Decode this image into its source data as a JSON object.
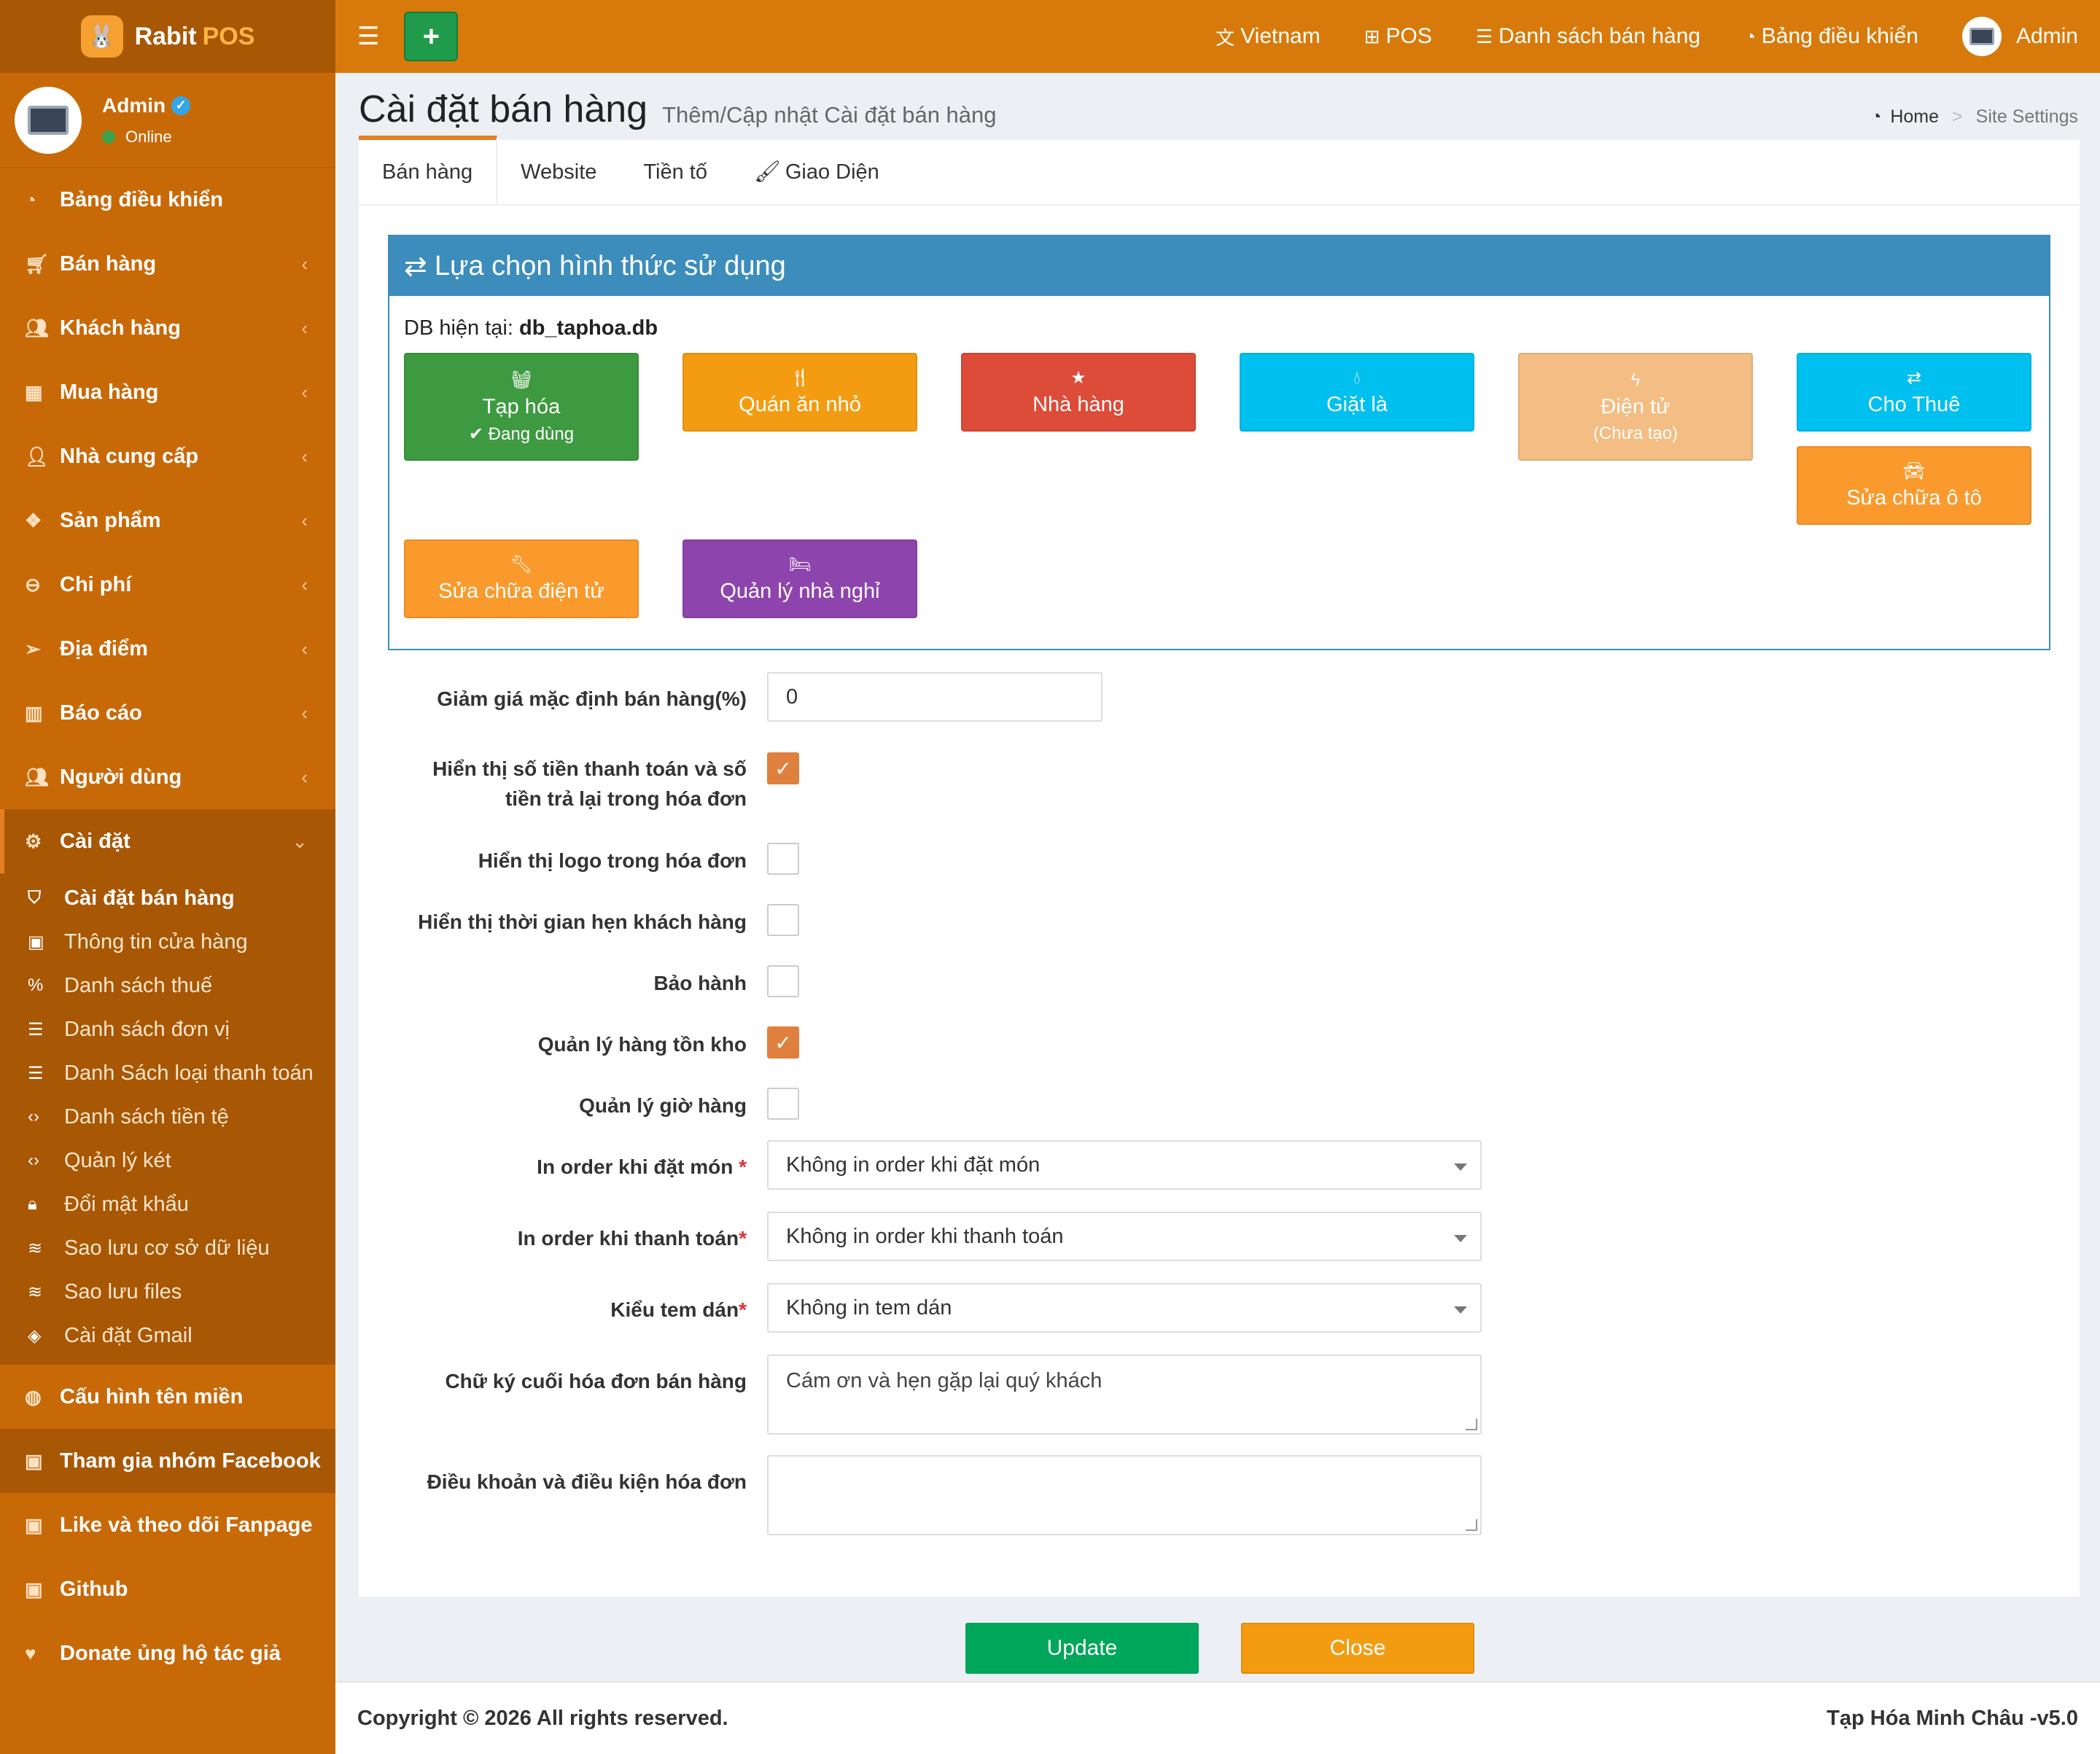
{
  "brand": {
    "name": "Rabit",
    "suffix": "POS"
  },
  "user": {
    "name": "Admin",
    "status": "Online"
  },
  "sidebar": {
    "items": [
      {
        "label": "Bảng điều khiển",
        "icon": "dashboard-icon"
      },
      {
        "label": "Bán hàng",
        "icon": "cart-icon"
      },
      {
        "label": "Khách hàng",
        "icon": "users-icon"
      },
      {
        "label": "Mua hàng",
        "icon": "grid-icon"
      },
      {
        "label": "Nhà cung cấp",
        "icon": "user-plus-icon"
      },
      {
        "label": "Sản phẩm",
        "icon": "cubes-icon"
      },
      {
        "label": "Chi phí",
        "icon": "minus-circle-icon"
      },
      {
        "label": "Địa điểm",
        "icon": "paper-plane-icon"
      },
      {
        "label": "Báo cáo",
        "icon": "bar-chart-icon"
      },
      {
        "label": "Người dùng",
        "icon": "users-icon"
      },
      {
        "label": "Cài đặt",
        "icon": "cogs-icon"
      }
    ],
    "sub": [
      {
        "label": "Cài đặt bán hàng",
        "icon": "shield-icon"
      },
      {
        "label": "Thông tin cửa hàng",
        "icon": "briefcase-icon"
      },
      {
        "label": "Danh sách thuế",
        "icon": "percent-icon"
      },
      {
        "label": "Danh sách đơn vị",
        "icon": "list-icon"
      },
      {
        "label": "Danh Sách loại thanh toán",
        "icon": "list-icon"
      },
      {
        "label": "Danh sách tiền tệ",
        "icon": "code-icon"
      },
      {
        "label": "Quản lý két",
        "icon": "code-icon"
      },
      {
        "label": "Đổi mật khẩu",
        "icon": "lock-icon"
      },
      {
        "label": "Sao lưu cơ sở dữ liệu",
        "icon": "database-icon"
      },
      {
        "label": "Sao lưu files",
        "icon": "database-icon"
      },
      {
        "label": "Cài đặt Gmail",
        "icon": "cube-icon"
      }
    ],
    "bottom": [
      {
        "label": "Cấu hình tên miền",
        "icon": "globe-icon"
      },
      {
        "label": "Tham gia nhóm Facebook",
        "icon": "briefcase-icon"
      },
      {
        "label": "Like và theo dõi Fanpage",
        "icon": "briefcase-icon"
      },
      {
        "label": "Github",
        "icon": "briefcase-icon"
      },
      {
        "label": "Donate ủng hộ tác giả",
        "icon": "heart-icon"
      }
    ]
  },
  "topnav": {
    "lang": "Vietnam",
    "pos": "POS",
    "sales": "Danh sách bán hàng",
    "dashboard": "Bảng điều khiển",
    "admin": "Admin"
  },
  "page": {
    "title": "Cài đặt bán hàng",
    "subtitle": "Thêm/Cập nhật Cài đặt bán hàng",
    "crumb_home": "Home",
    "crumb_current": "Site Settings"
  },
  "tabs": [
    "Bán hàng",
    "Website",
    "Tiền tố",
    "Giao Diện"
  ],
  "panel": {
    "title": "Lựa chọn hình thức sử dụng",
    "db_label": "DB hiện tại:",
    "db_value": "db_taphoa.db"
  },
  "tiles": [
    {
      "label": "Tạp hóa",
      "note": "✔ Đang dùng",
      "color": "#3d9a40",
      "icon": "basket-icon"
    },
    {
      "label": "Quán ăn nhỏ",
      "note": "",
      "color": "#f39c12",
      "icon": "utensils-icon"
    },
    {
      "label": "Nhà hàng",
      "note": "",
      "color": "#dd4b39",
      "icon": "star-icon"
    },
    {
      "label": "Giặt là",
      "note": "",
      "color": "#00c0ef",
      "icon": "drop-icon"
    },
    {
      "label": "Điện tử",
      "note": "(Chưa tạo)",
      "color": "#f3bd83",
      "icon": "bolt-icon"
    },
    {
      "label": "Cho Thuê",
      "note": "",
      "color": "#00c0ef",
      "icon": "exchange-icon"
    },
    {
      "label": "Sửa chữa ô tô",
      "note": "",
      "color": "#fa9a2c",
      "icon": "car-icon"
    },
    {
      "label": "Sửa chữa điện tử",
      "note": "",
      "color": "#fa9a2c",
      "icon": "wrench-icon"
    },
    {
      "label": "Quản lý nhà nghỉ",
      "note": "",
      "color": "#8e44ad",
      "icon": "bed-icon"
    }
  ],
  "form": {
    "discount_label": "Giảm giá mặc định bán hàng(%)",
    "discount_value": "0",
    "show_pay_label": "Hiển thị số tiền thanh toán và số tiền trả lại trong hóa đơn",
    "show_pay_checked": true,
    "show_logo_label": "Hiển thị logo trong hóa đơn",
    "show_logo_checked": false,
    "show_time_label": "Hiển thị thời gian hẹn khách hàng",
    "show_time_checked": false,
    "warranty_label": "Bảo hành",
    "warranty_checked": false,
    "stock_label": "Quản lý hàng tồn kho",
    "stock_checked": true,
    "hours_label": "Quản lý giờ hàng",
    "hours_checked": false,
    "print_order_label": "In order khi đặt món ",
    "print_order_value": "Không in order khi đặt món",
    "print_pay_label": "In order khi thanh toán",
    "print_pay_value": "Không in order khi thanh toán",
    "sticker_label": "Kiểu tem dán",
    "sticker_value": "Không in tem dán",
    "signature_label": "Chữ ký cuối hóa đơn bán hàng",
    "signature_value": "Cám ơn và hẹn gặp lại quý khách",
    "terms_label": "Điều khoản và điều kiện hóa đơn",
    "terms_value": "",
    "required_mark": "*"
  },
  "buttons": {
    "update": "Update",
    "close": "Close",
    "update_color": "#00a65a",
    "close_color": "#f39c12"
  },
  "footer": {
    "copyright": "Copyright © 2026 All rights reserved.",
    "version": "Tạp Hóa Minh Châu -v5.0"
  }
}
